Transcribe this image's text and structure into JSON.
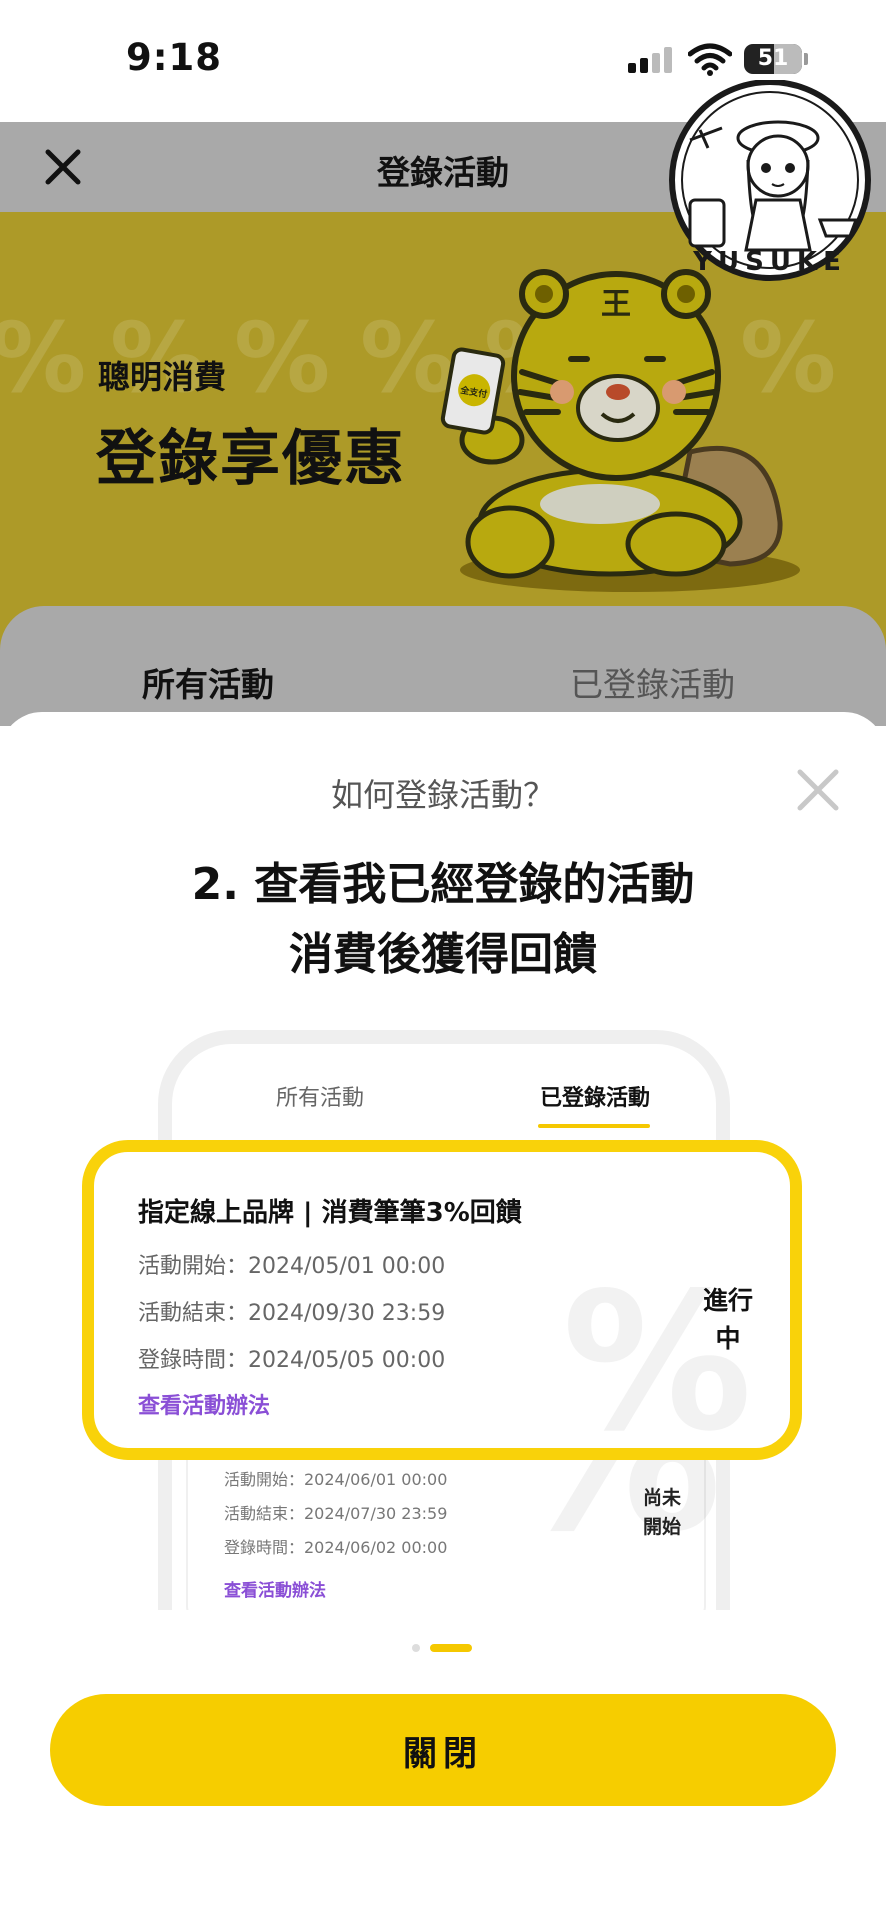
{
  "status_bar": {
    "time": "9:18",
    "battery": "51",
    "battery_fraction": 0.51,
    "icons": [
      "signal-icon",
      "wifi-icon",
      "battery-icon"
    ]
  },
  "nav": {
    "title": "登錄活動",
    "close_icon": "close-icon"
  },
  "banner": {
    "subtitle": "聰明消費",
    "title": "登錄享優惠",
    "pattern_symbol": "%",
    "mascot_phone_text": "全支付",
    "mascot_forehead": "王"
  },
  "watermark": {
    "text": "YUSUKE"
  },
  "tabs": {
    "all": "所有活動",
    "registered": "已登錄活動"
  },
  "sheet": {
    "title": "如何登錄活動？",
    "step_line1": "2. 查看我已經登錄的活動",
    "step_line2": "消費後獲得回饋",
    "mockup": {
      "tab_all": "所有活動",
      "tab_registered": "已登錄活動",
      "second_card": {
        "start": "活動開始：2024/06/01 00:00",
        "end": "活動結束：2024/07/30 23:59",
        "registered": "登錄時間：2024/06/02 00:00",
        "link": "查看活動辦法",
        "status_line1": "尚未",
        "status_line2": "開始"
      }
    },
    "highlight_card": {
      "name": "指定線上品牌 | 消費筆筆3%回饋",
      "start": "活動開始：2024/05/01 00:00",
      "end": "活動結束：2024/09/30 23:59",
      "registered": "登錄時間：2024/05/05 00:00",
      "link": "查看活動辦法",
      "status_line1": "進行",
      "status_line2": "中"
    },
    "pager": {
      "total": 2,
      "current": 2
    },
    "close_button": "關閉"
  },
  "colors": {
    "brand_yellow": "#f6cd00",
    "highlight_border": "#f9d20a",
    "link_purple": "#8a4fd6",
    "overlay_gray": "#a9a9a9",
    "banner_dimmed": "#ad9a28"
  }
}
